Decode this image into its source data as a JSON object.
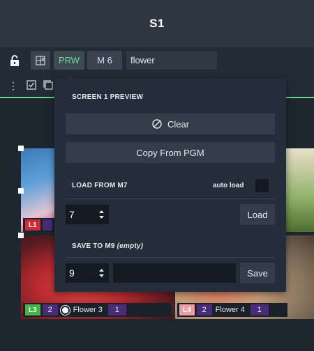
{
  "window": {
    "title": "S1"
  },
  "toolbar": {
    "prw_label": "PRW",
    "memory_label": "M 6",
    "name_value": "flower"
  },
  "popup": {
    "preview_title": "SCREEN 1 PREVIEW",
    "clear_label": "Clear",
    "copy_label": "Copy From PGM",
    "load_title": "LOAD FROM M7",
    "autoload_label": "auto load",
    "load_value": "7",
    "load_button": "Load",
    "save_title": "SAVE TO M9",
    "save_status": "(empty)",
    "save_value": "9",
    "save_button": "Save"
  },
  "layers": [
    {
      "tag": "L1",
      "color": "#d2283a",
      "num": ""
    },
    {
      "tag": "L3",
      "color": "#43b649",
      "num": "2",
      "name": "Flower 3",
      "count": "1"
    },
    {
      "tag": "L4",
      "color": "#e8a0a6",
      "num": "2",
      "name": "Flower 4",
      "count": "1"
    }
  ],
  "colors": {
    "accent_green": "#6fd38e",
    "prw_text": "#6fd8a8",
    "layer_purple": "#4a2d78"
  }
}
